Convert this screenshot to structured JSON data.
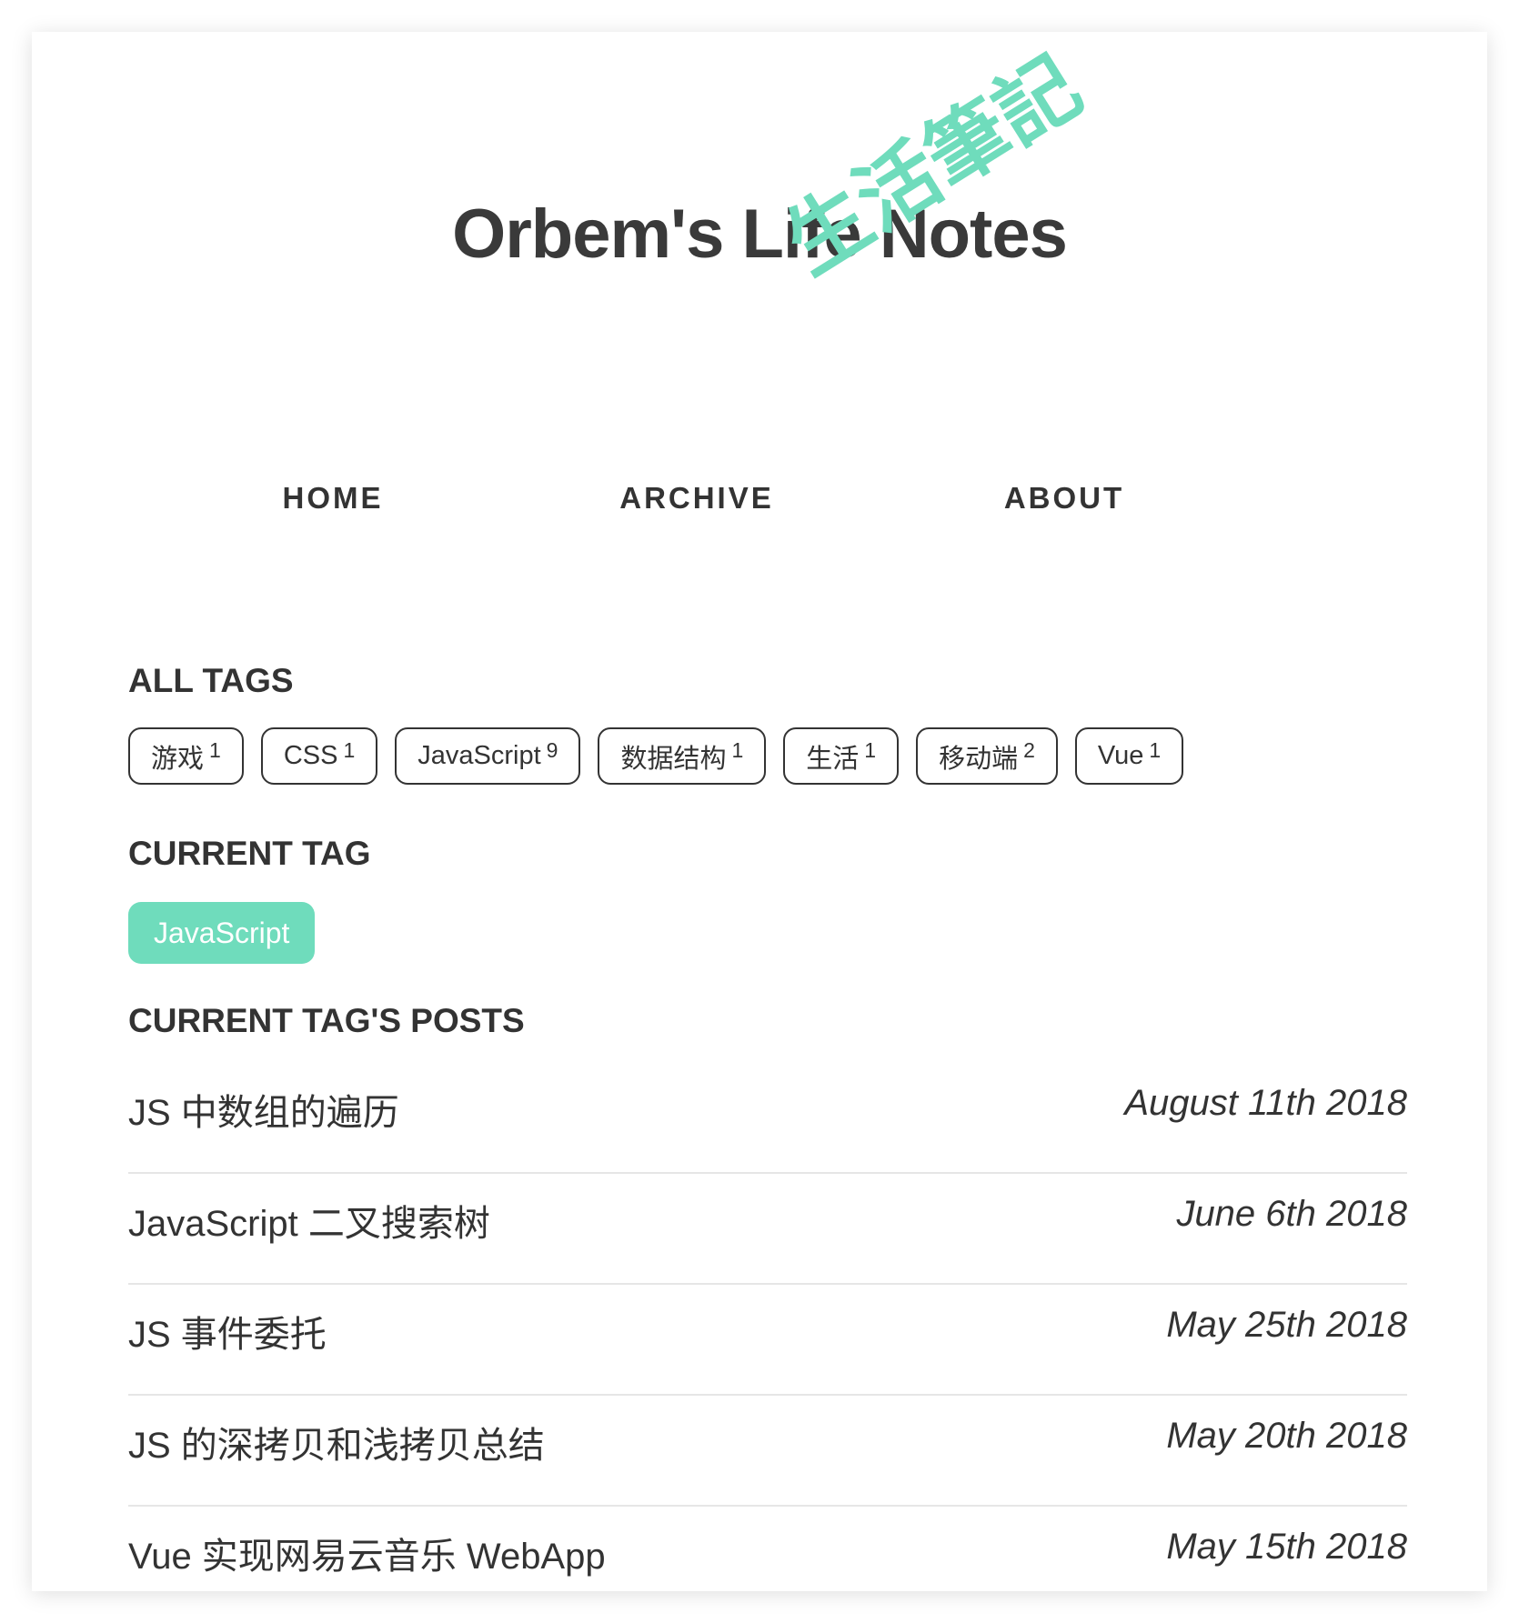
{
  "site": {
    "title": "Orbem's Life Notes",
    "stamp": "生活筆記"
  },
  "nav": {
    "items": [
      {
        "label": "HOME"
      },
      {
        "label": "ARCHIVE"
      },
      {
        "label": "ABOUT"
      }
    ]
  },
  "all_tags": {
    "heading": "ALL TAGS",
    "items": [
      {
        "name": "游戏",
        "count": "1"
      },
      {
        "name": "CSS",
        "count": "1"
      },
      {
        "name": "JavaScript",
        "count": "9"
      },
      {
        "name": "数据结构",
        "count": "1"
      },
      {
        "name": "生活",
        "count": "1"
      },
      {
        "name": "移动端",
        "count": "2"
      },
      {
        "name": "Vue",
        "count": "1"
      }
    ]
  },
  "current_tag": {
    "heading": "CURRENT TAG",
    "name": "JavaScript"
  },
  "posts": {
    "heading": "CURRENT TAG'S POSTS",
    "items": [
      {
        "title": "JS 中数组的遍历",
        "date": "August 11th 2018"
      },
      {
        "title": "JavaScript 二叉搜索树",
        "date": "June 6th 2018"
      },
      {
        "title": "JS 事件委托",
        "date": "May 25th 2018"
      },
      {
        "title": "JS 的深拷贝和浅拷贝总结",
        "date": "May 20th 2018"
      },
      {
        "title": "Vue 实现网易云音乐 WebApp",
        "date": "May 15th 2018"
      }
    ]
  },
  "colors": {
    "accent": "#6fdcbc",
    "text": "#333333",
    "divider": "#e6e6e6"
  }
}
